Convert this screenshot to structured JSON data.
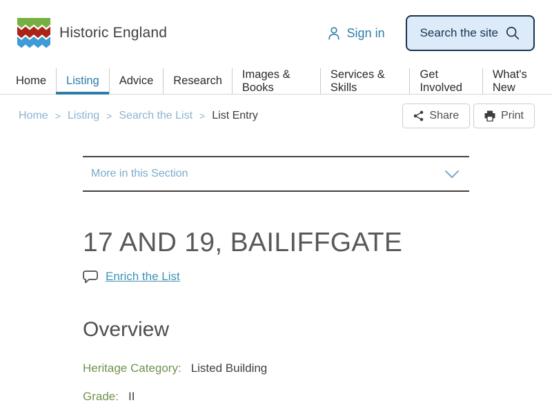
{
  "header": {
    "brand": "Historic England",
    "sign_in_label": "Sign in",
    "search_button_label": "Search the site"
  },
  "nav": {
    "items": [
      {
        "label": "Home",
        "active": false
      },
      {
        "label": "Listing",
        "active": true
      },
      {
        "label": "Advice",
        "active": false
      },
      {
        "label": "Research",
        "active": false
      },
      {
        "label": "Images & Books",
        "active": false
      },
      {
        "label": "Services & Skills",
        "active": false
      },
      {
        "label": "Get Involved",
        "active": false
      },
      {
        "label": "What's New",
        "active": false
      }
    ]
  },
  "breadcrumb": {
    "items": [
      "Home",
      "Listing",
      "Search the List",
      "List Entry"
    ],
    "separator": ">"
  },
  "actions": {
    "share_label": "Share",
    "print_label": "Print"
  },
  "section_nav": {
    "label": "More in this Section"
  },
  "page": {
    "title": "17 AND 19, BAILIFFGATE",
    "enrich_label": "Enrich the List"
  },
  "overview": {
    "heading": "Overview",
    "fields": [
      {
        "label": "Heritage Category:",
        "value": "Listed Building"
      },
      {
        "label": "Grade:",
        "value": "II"
      }
    ]
  },
  "colors": {
    "logo_green": "#76b043",
    "logo_red": "#ab2418",
    "logo_blue": "#3d9bd5",
    "accent_blue": "#2c7cab",
    "light_blue": "#8cb3d0",
    "navy": "#16334d",
    "search_bg": "#ddeafa",
    "label_green": "#71924d",
    "title_gray": "#595959"
  }
}
